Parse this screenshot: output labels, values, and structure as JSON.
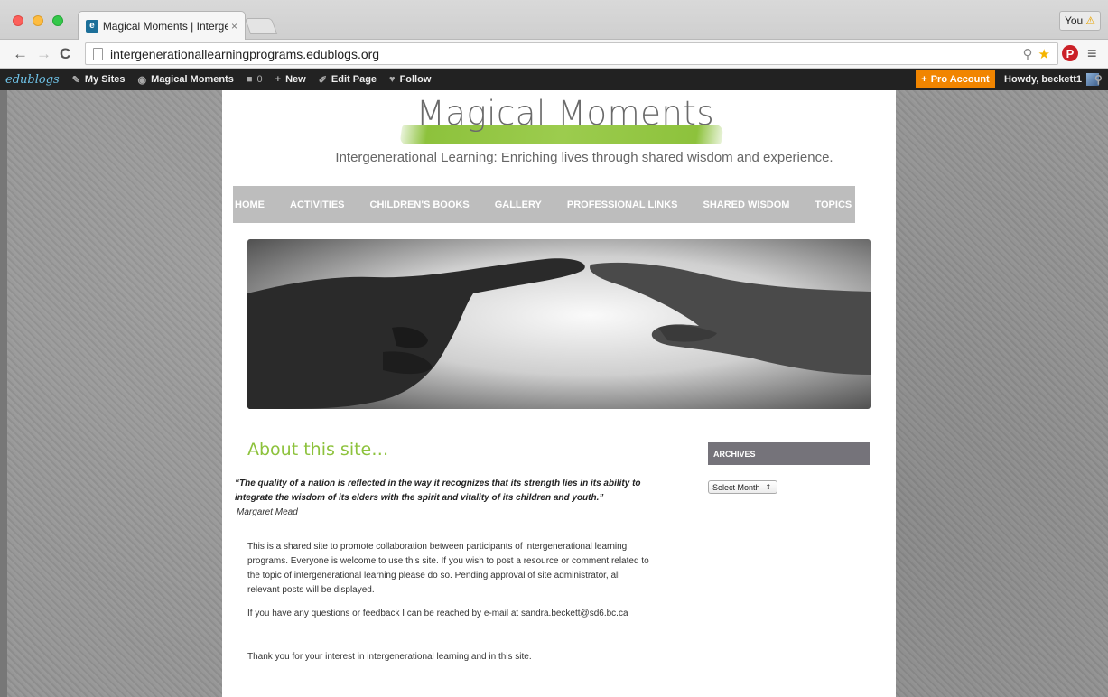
{
  "browser": {
    "tab_title": "Magical Moments | Interge",
    "tab_close": "×",
    "profile_label": "You",
    "profile_warning": "⚠",
    "url": "intergenerationallearningprograms.edublogs.org",
    "icons": [
      "back-icon",
      "forward-icon",
      "reload-icon",
      "zoom-icon",
      "star-icon",
      "pinterest-icon",
      "menu-icon"
    ]
  },
  "adminbar": {
    "logo": "edublogs",
    "items": [
      {
        "label": "My Sites"
      },
      {
        "label": "Magical Moments"
      },
      {
        "label": "0"
      },
      {
        "label": "New"
      },
      {
        "label": "Edit Page"
      },
      {
        "label": "Follow"
      }
    ],
    "pro_label": "Pro Account",
    "howdy": "Howdy, beckett1",
    "accent": "#f18500"
  },
  "site": {
    "title": "Magical Moments",
    "tagline": "Intergenerational Learning: Enriching lives through shared wisdom and experience.",
    "brand_green": "#8dc23c"
  },
  "nav": {
    "items": [
      {
        "label": "HOME"
      },
      {
        "label": "ACTIVITIES"
      },
      {
        "label": "CHILDREN'S BOOKS"
      },
      {
        "label": "GALLERY"
      },
      {
        "label": "PROFESSIONAL LINKS"
      },
      {
        "label": "SHARED WISDOM"
      },
      {
        "label": "TOPICS"
      }
    ]
  },
  "post": {
    "title": "About this site…",
    "quote": "“The quality of a nation is reflected in the way it recognizes that its strength lies in its ability to integrate the wisdom of its elders with the spirit and vitality of its children and youth.”",
    "quote_author": "Margaret Mead",
    "paragraphs": [
      "This is a shared site to promote collaboration between participants of intergenerational learning programs. Everyone is welcome to use this site. If you wish to post a resource or comment related to the topic of intergenerational learning please do so. Pending approval of site administrator, all relevant posts will be displayed.",
      "If you have any questions or feedback I can be reached by e-mail at sandra.beckett@sd6.bc.ca",
      "Thank you for your interest in intergenerational learning and in this site."
    ]
  },
  "sidebar": {
    "archives_heading": "ARCHIVES",
    "select_value": "Select Month"
  }
}
